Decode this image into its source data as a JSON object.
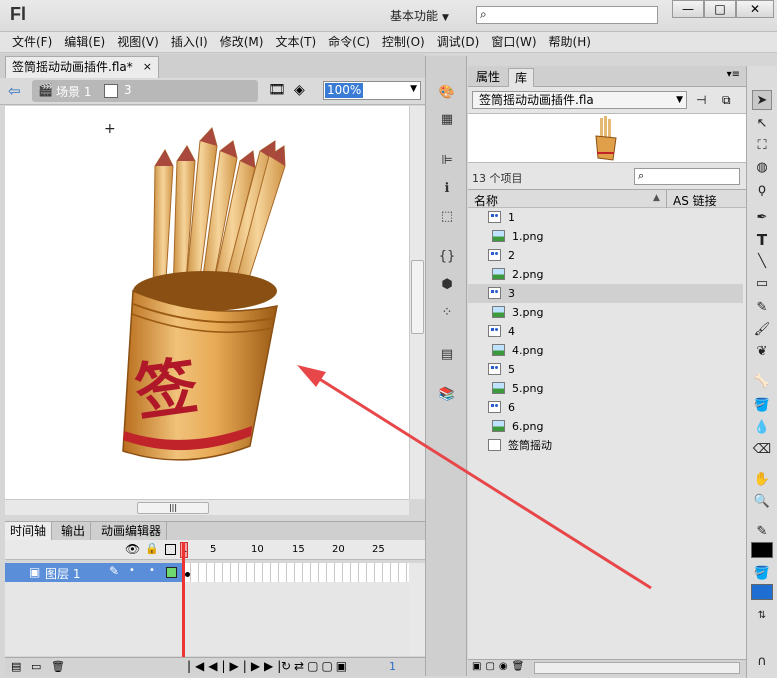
{
  "app": {
    "logo": "Fl",
    "workspace": "基本功能",
    "search_placeholder": ""
  },
  "window_controls": {
    "minimize": "—",
    "maximize": "□",
    "close": "✕"
  },
  "menu": [
    "文件(F)",
    "编辑(E)",
    "视图(V)",
    "插入(I)",
    "修改(M)",
    "文本(T)",
    "命令(C)",
    "控制(O)",
    "调试(D)",
    "窗口(W)",
    "帮助(H)"
  ],
  "document": {
    "tab_title": "签筒摇动动画插件.fla*",
    "close": "×"
  },
  "editbar": {
    "scene": "场景 1",
    "symbol": "3",
    "zoom": "100%"
  },
  "timeline": {
    "tabs": [
      "时间轴",
      "输出",
      "动画编辑器"
    ],
    "frame_numbers": [
      "1",
      "5",
      "10",
      "15",
      "20",
      "25"
    ],
    "layer_name": "图层 1",
    "current_frame": "1"
  },
  "library": {
    "tabs": [
      "属性",
      "库"
    ],
    "file": "签筒摇动动画插件.fla",
    "count": "13 个项目",
    "col_name": "名称",
    "col_link": "AS 链接",
    "items": [
      {
        "name": "1",
        "type": "graphic"
      },
      {
        "name": "1.png",
        "type": "bitmap"
      },
      {
        "name": "2",
        "type": "graphic"
      },
      {
        "name": "2.png",
        "type": "bitmap"
      },
      {
        "name": "3",
        "type": "graphic",
        "selected": true
      },
      {
        "name": "3.png",
        "type": "bitmap"
      },
      {
        "name": "4",
        "type": "graphic"
      },
      {
        "name": "4.png",
        "type": "bitmap"
      },
      {
        "name": "5",
        "type": "graphic"
      },
      {
        "name": "5.png",
        "type": "bitmap"
      },
      {
        "name": "6",
        "type": "graphic"
      },
      {
        "name": "6.png",
        "type": "bitmap"
      },
      {
        "name": "签筒摇动",
        "type": "movieclip"
      }
    ]
  },
  "stage_art": {
    "character": "签"
  },
  "colors": {
    "accent": "#3a7bd5",
    "arrow": "#e8474a",
    "layer_row": "#5a8ed8"
  }
}
